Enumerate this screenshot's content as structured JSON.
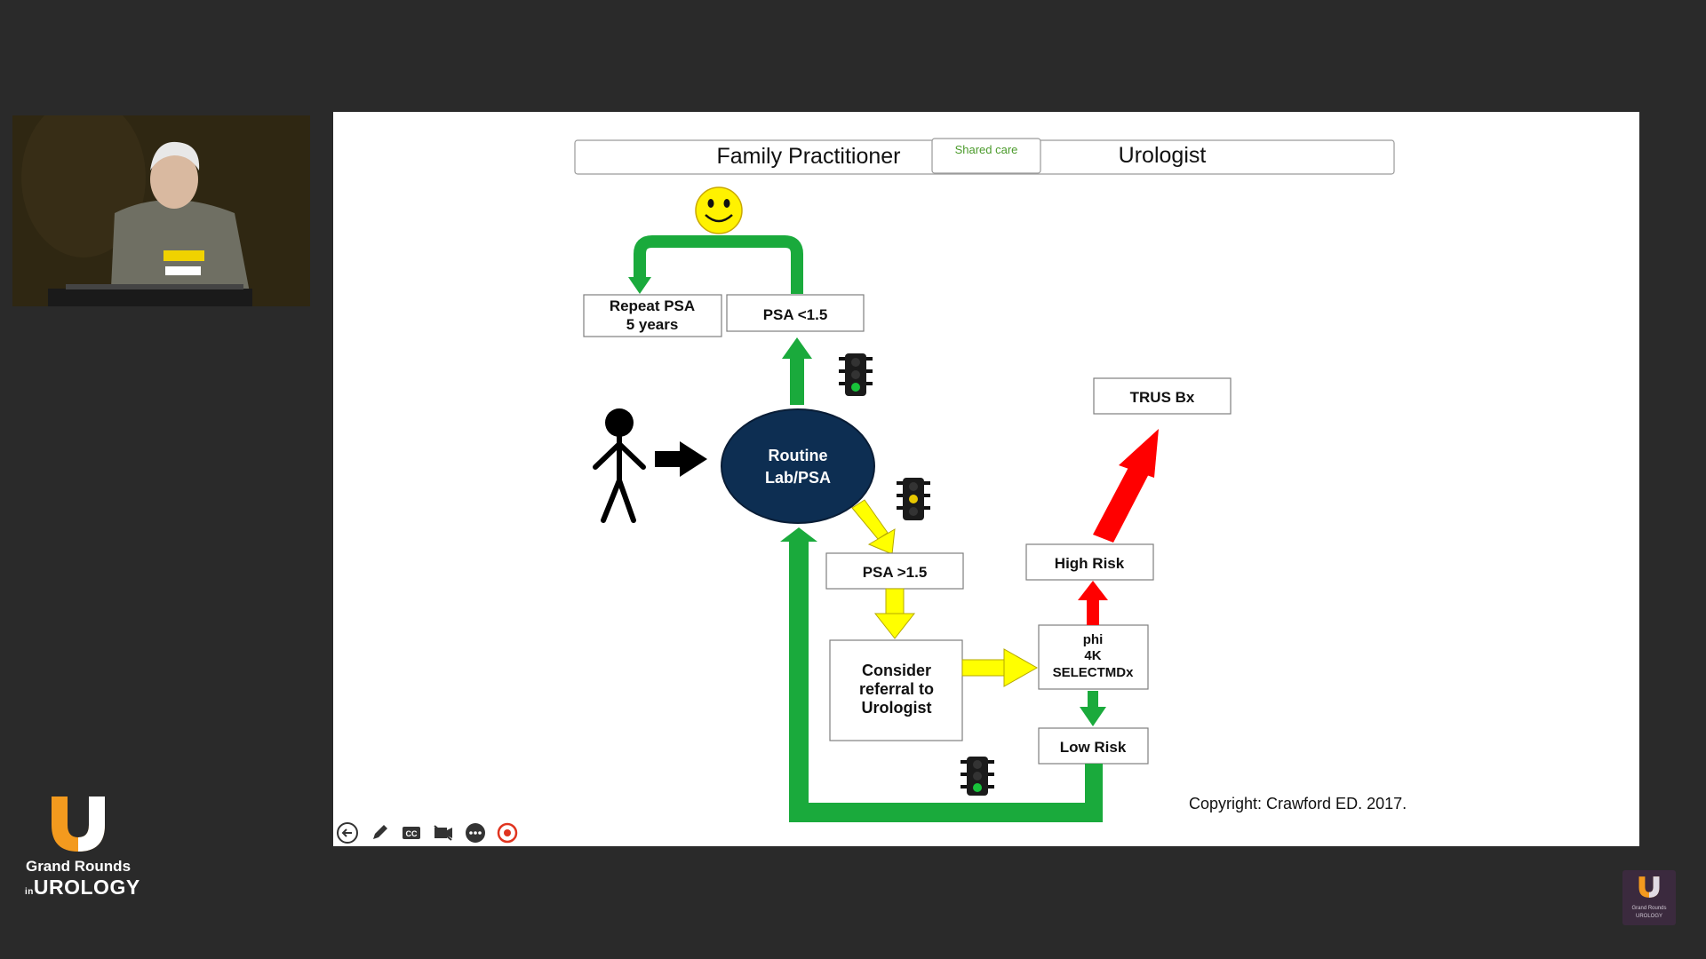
{
  "slide": {
    "header": {
      "left": "Family Practitioner",
      "middle": "Shared care",
      "right": "Urologist"
    },
    "boxes": {
      "repeat_psa_line1": "Repeat PSA",
      "repeat_psa_line2": "5 years",
      "psa_low": "PSA <1.5",
      "trus_bx": "TRUS Bx",
      "routine_line1": "Routine",
      "routine_line2": "Lab/PSA",
      "high_risk": "High Risk",
      "psa_high": "PSA >1.5",
      "consider_line1": "Consider",
      "consider_line2": "referral  to",
      "consider_line3": "Urologist",
      "phi_line1": "phi",
      "phi_line2": "4K",
      "phi_line3": "SELECTMDx",
      "low_risk": "Low Risk"
    },
    "copyright": "Copyright: Crawford ED. 2017."
  },
  "brand": {
    "line1": "Grand Rounds",
    "line2_prefix": "in",
    "line2": "UROLOGY",
    "watermark_line1": "Grand Rounds",
    "watermark_line2": "UROLOGY"
  },
  "toolbar": {
    "icons": [
      "back-arrow-icon",
      "pen-icon",
      "closed-captions-icon",
      "video-icon",
      "more-options-icon",
      "pointer-icon"
    ]
  },
  "colors": {
    "green": "#1aaa3c",
    "yellow": "#ffff00",
    "red": "#ff0000",
    "navy": "#0d2e52",
    "brand_orange": "#f39a1e",
    "smiley": "#fff200"
  }
}
